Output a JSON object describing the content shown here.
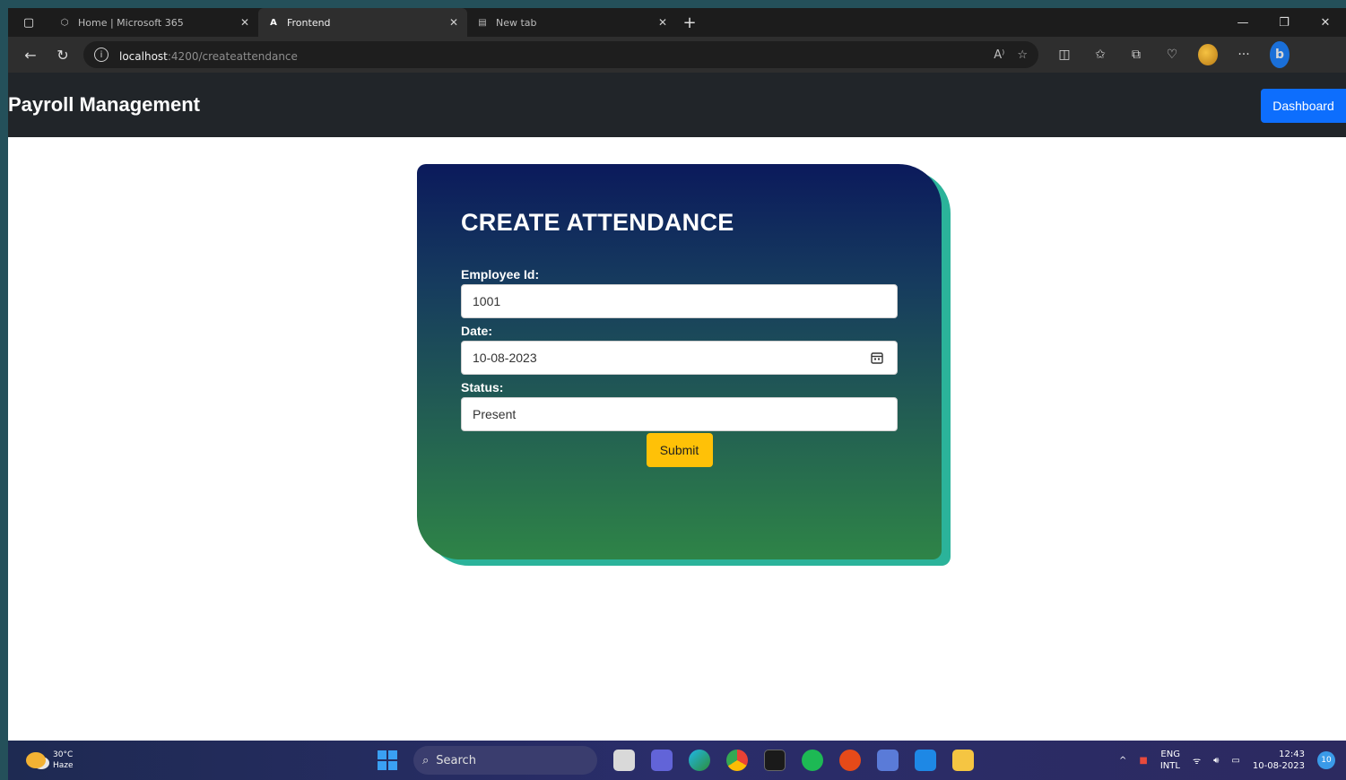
{
  "browser": {
    "tabs": [
      {
        "title": "Home | Microsoft 365",
        "active": false
      },
      {
        "title": "Frontend",
        "active": true
      },
      {
        "title": "New tab",
        "active": false
      }
    ],
    "url_host": "localhost",
    "url_path": ":4200/createattendance"
  },
  "navbar": {
    "brand": "Payroll Management",
    "dashboard_label": "Dashboard"
  },
  "form": {
    "title": "CREATE ATTENDANCE",
    "employee_id_label": "Employee Id:",
    "employee_id_value": "1001",
    "date_label": "Date:",
    "date_value": "10-08-2023",
    "status_label": "Status:",
    "status_value": "Present",
    "submit_label": "Submit"
  },
  "taskbar": {
    "weather_temp": "30°C",
    "weather_desc": "Haze",
    "search_label": "Search",
    "lang_top": "ENG",
    "lang_bottom": "INTL",
    "time": "12:43",
    "date": "10-08-2023",
    "notification_count": "10"
  },
  "colors": {
    "navbar_bg": "#212529",
    "dashboard_button": "#0d6efd",
    "submit_button": "#ffc107",
    "card_gradient_top": "#0b1a5c",
    "card_gradient_bottom": "#2e8447",
    "card_shadow": "#2bb39a"
  }
}
